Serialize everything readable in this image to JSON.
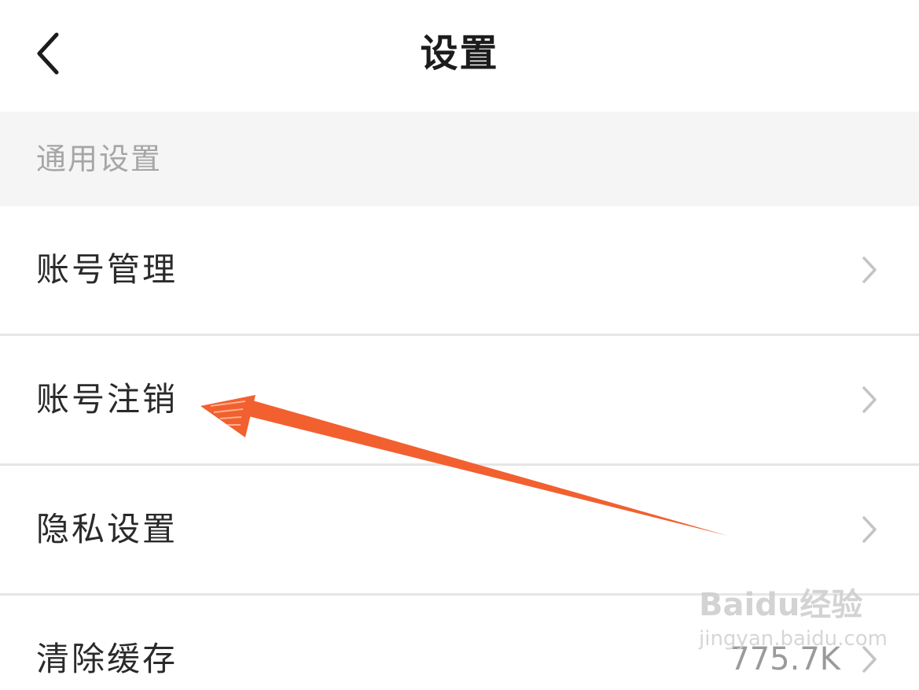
{
  "header": {
    "title": "设置",
    "back_icon": "chevron-left-icon"
  },
  "section": {
    "title": "通用设置"
  },
  "rows": [
    {
      "label": "账号管理",
      "value": "",
      "icon": "chevron-right-icon"
    },
    {
      "label": "账号注销",
      "value": "",
      "icon": "chevron-right-icon"
    },
    {
      "label": "隐私设置",
      "value": "",
      "icon": "chevron-right-icon"
    },
    {
      "label": "清除缓存",
      "value": "775.7K",
      "icon": "chevron-right-icon"
    }
  ],
  "annotation": {
    "color": "#f2602f",
    "points_to": "账号注销"
  },
  "watermark": {
    "brand": "Baidu经验",
    "url": "jingyan.baidu.com"
  },
  "colors": {
    "background": "#ffffff",
    "section_bg": "#f5f5f5",
    "divider": "#e6e6e6",
    "text_primary": "#2a2a2a",
    "text_secondary": "#a6a6a6",
    "chevron": "#c4c4c4"
  }
}
